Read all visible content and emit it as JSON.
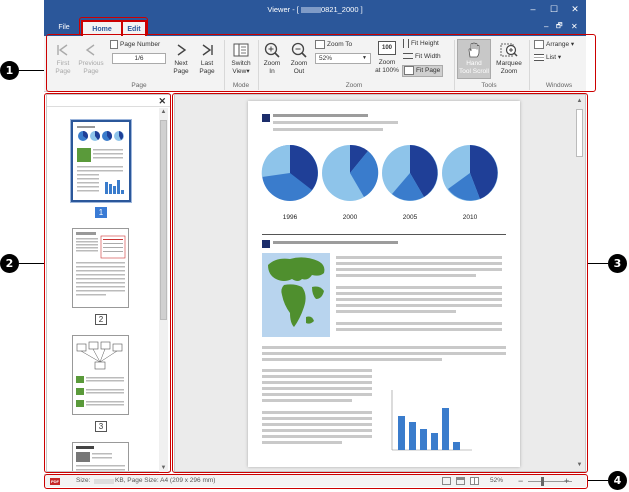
{
  "window": {
    "title": "Viewer - [ ",
    "title_suffix": "0821_2000 ]",
    "controls": [
      "–",
      "☐",
      "✕"
    ],
    "mini_controls": [
      "–",
      "🗗",
      "✕"
    ]
  },
  "tabs": [
    {
      "label": "File"
    },
    {
      "label": "Home"
    },
    {
      "label": "Edit"
    }
  ],
  "ribbon": {
    "page": {
      "first": "First\nPage",
      "previous": "Previous\nPage",
      "page_number_label": "Page Number",
      "page_number_value": "1/6",
      "next": "Next\nPage",
      "last": "Last\nPage",
      "group": "Page"
    },
    "mode": {
      "switch_view": "Switch\nView▾",
      "group": "Mode"
    },
    "zoom": {
      "zoom_in": "Zoom\nIn",
      "zoom_out": "Zoom\nOut",
      "zoom_to": "Zoom To",
      "zoom_value": "52%",
      "zoom_100": "Zoom\nat 100%",
      "zoom_100_icon": "100",
      "fit_height": "Fit Height",
      "fit_width": "Fit Width",
      "fit_page": "Fit Page",
      "group": "Zoom"
    },
    "tools": {
      "hand": "Hand\nTool Scroll",
      "marquee": "Marquee\nZoom",
      "group": "Tools"
    },
    "windows": {
      "arrange": "Arrange ▾",
      "list": "List ▾",
      "group": "Windows"
    }
  },
  "thumbnails": {
    "close": "✕",
    "pages": [
      {
        "number": "1",
        "selected": true
      },
      {
        "number": "2",
        "selected": false
      },
      {
        "number": "3",
        "selected": false
      }
    ]
  },
  "document": {
    "pie_years": [
      "1996",
      "2000",
      "2005",
      "2010"
    ],
    "pie_colors": {
      "dark": "#1f3f97",
      "mid": "#3a7ccc",
      "light": "#8ec4ea"
    }
  },
  "statusbar": {
    "size_prefix": "Size:",
    "size_suffix": "KB, Page Size: A4 (209 x 296 mm)",
    "zoom": "52%",
    "minus": "−",
    "plus": "+"
  },
  "callouts": [
    "1",
    "2",
    "3",
    "4"
  ]
}
